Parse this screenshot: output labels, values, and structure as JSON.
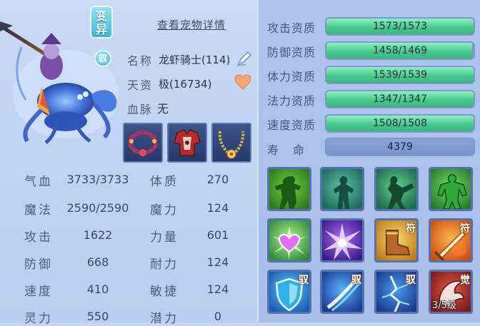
{
  "pet": {
    "mutate_badge": "变异",
    "tame_badge": "驭",
    "detail_link": "查看宠物详情",
    "name_label": "名称",
    "name_value": "龙虾骑士(114)",
    "talent_label": "天资",
    "talent_value": "极(16734)",
    "bloodline_label": "血脉",
    "bloodline_value": "无"
  },
  "equipment": [
    {
      "icon": "red-gem-necklace-icon"
    },
    {
      "icon": "red-armor-icon"
    },
    {
      "icon": "gold-bead-necklace-icon"
    }
  ],
  "stats": [
    {
      "label": "气血",
      "value": "3733/3733",
      "label2": "体质",
      "value2": "270"
    },
    {
      "label": "魔法",
      "value": "2590/2590",
      "label2": "魔力",
      "value2": "124"
    },
    {
      "label": "攻击",
      "value": "1622",
      "label2": "力量",
      "value2": "601"
    },
    {
      "label": "防御",
      "value": "668",
      "label2": "耐力",
      "value2": "124"
    },
    {
      "label": "速度",
      "value": "410",
      "label2": "敏捷",
      "value2": "124"
    },
    {
      "label": "灵力",
      "value": "550",
      "label2": "潜力",
      "value2": "0"
    }
  ],
  "aptitudes": [
    {
      "label": "攻击资质",
      "text": "1573/1573",
      "fill": 1.0
    },
    {
      "label": "防御资质",
      "text": "1458/1469",
      "fill": 0.992
    },
    {
      "label": "体力资质",
      "text": "1539/1539",
      "fill": 1.0
    },
    {
      "label": "法力资质",
      "text": "1347/1347",
      "fill": 1.0
    },
    {
      "label": "速度资质",
      "text": "1508/1508",
      "fill": 1.0
    }
  ],
  "lifespan": {
    "label": "寿　命",
    "value": "4379"
  },
  "skills": [
    {
      "icon": "strength-pose-icon",
      "tag": "",
      "level": ""
    },
    {
      "icon": "figure-silhouette-icon",
      "tag": "",
      "level": ""
    },
    {
      "icon": "kick-pose-icon",
      "tag": "",
      "level": ""
    },
    {
      "icon": "muscle-body-icon",
      "tag": "",
      "level": ""
    },
    {
      "icon": "heart-burst-icon",
      "tag": "",
      "level": ""
    },
    {
      "icon": "purple-burst-icon",
      "tag": "",
      "level": ""
    },
    {
      "icon": "boot-talisman-icon",
      "tag": "符",
      "level": ""
    },
    {
      "icon": "sword-talisman-icon",
      "tag": "符",
      "level": ""
    },
    {
      "icon": "shield-icon",
      "tag": "驭",
      "level": ""
    },
    {
      "icon": "ice-slash-icon",
      "tag": "驭",
      "level": ""
    },
    {
      "icon": "crack-icon",
      "tag": "驭",
      "level": ""
    },
    {
      "icon": "red-dragon-icon",
      "tag": "觉",
      "level": "3/5级"
    }
  ],
  "colors": {
    "accent": "#49c98e",
    "panel": "#b9cdf0",
    "skill_border": "#5272b0"
  }
}
